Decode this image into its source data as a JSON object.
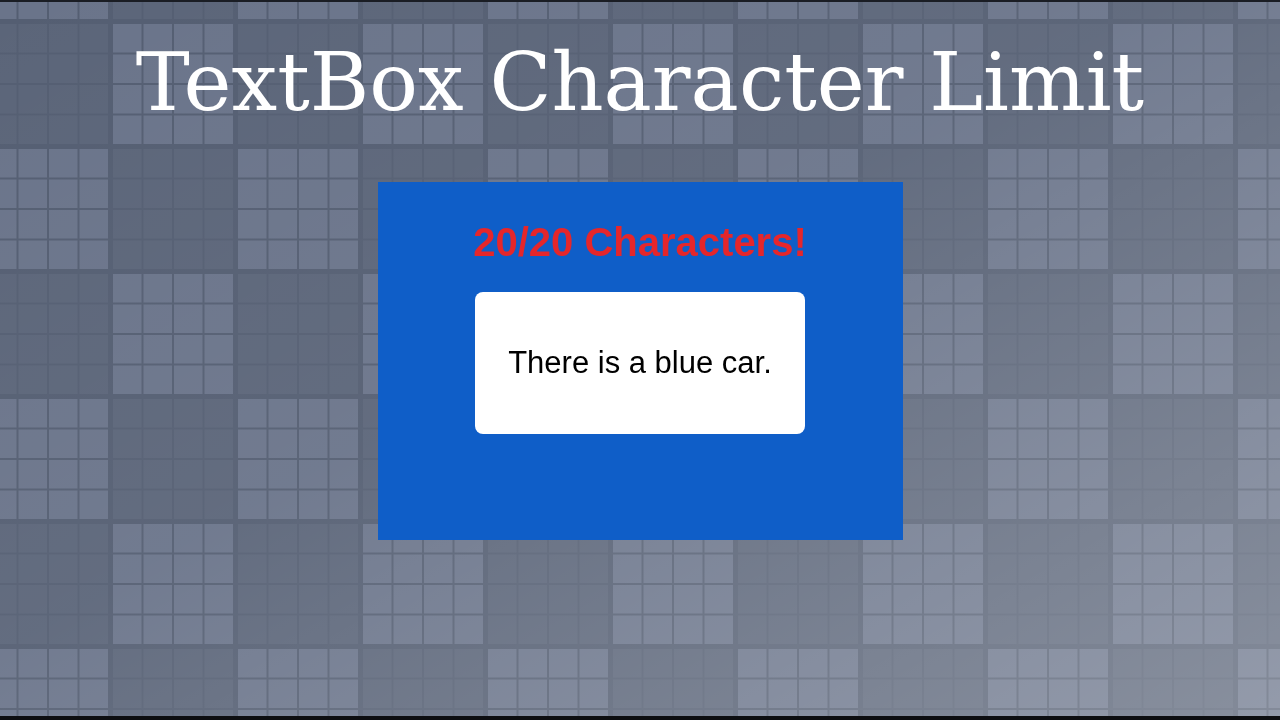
{
  "title": "TextBox Character Limit",
  "panel": {
    "counter": "20/20 Characters!",
    "textbox": {
      "value": "There is a blue car."
    }
  }
}
